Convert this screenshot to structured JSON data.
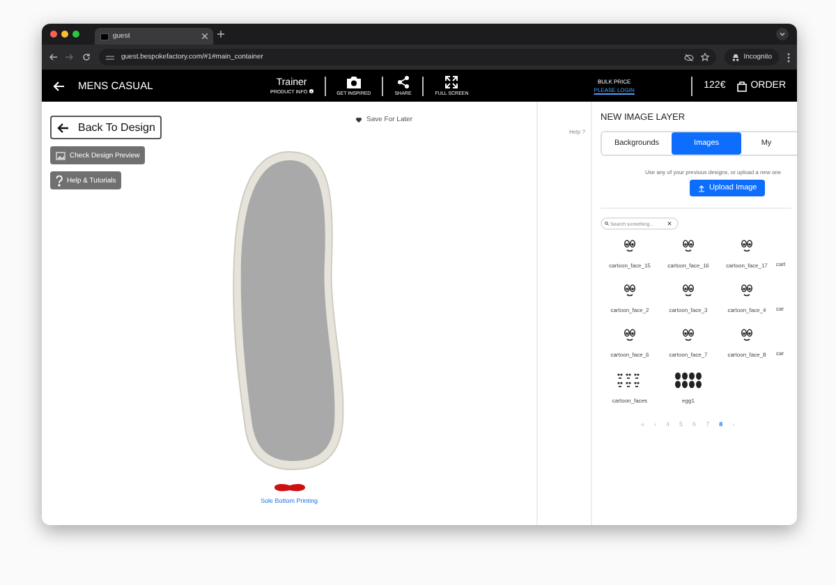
{
  "browser": {
    "tab_title": "guest",
    "url": "guest.bespokefactory.com/#1#main_container",
    "profile": "Incognito"
  },
  "header": {
    "title": "MENS CASUAL",
    "product": "Trainer",
    "product_info": "PRODUCT INFO",
    "actions": [
      {
        "kind": "camera",
        "label": "GET INSPIRED"
      },
      {
        "kind": "share",
        "label": "SHARE"
      },
      {
        "kind": "fullscreen",
        "label": "FULL SCREEN"
      }
    ],
    "bulk_price": "BULK PRICE",
    "login": "PLEASE LOGIN",
    "price": "122€",
    "order": "ORDER"
  },
  "design": {
    "buttons": [
      {
        "kind": "back",
        "label": "Back To Design"
      },
      {
        "kind": "preview",
        "label": "Check Design Preview"
      },
      {
        "kind": "help",
        "label": "Help & Tutorials"
      }
    ],
    "save": "Save For Later",
    "sole_link": "Sole Bottom Printing",
    "help": "Help ?"
  },
  "panel": {
    "title": "NEW IMAGE LAYER",
    "tabs": [
      {
        "label": "Backgrounds",
        "selected": false
      },
      {
        "label": "Images",
        "selected": true
      },
      {
        "label": "My",
        "selected": false
      }
    ],
    "hint": "Use any of your previous designs, or upload a new one",
    "upload": "Upload Image",
    "search": {
      "placeholder": "Search something..."
    },
    "images": [
      {
        "kind": "face",
        "label": "cartoon_face_15"
      },
      {
        "kind": "face",
        "label": "cartoon_face_16"
      },
      {
        "kind": "face",
        "label": "cartoon_face_17"
      },
      {
        "kind": "partial",
        "label": "cart"
      },
      {
        "kind": "face",
        "label": "cartoon_face_2"
      },
      {
        "kind": "face",
        "label": "cartoon_face_3"
      },
      {
        "kind": "face",
        "label": "cartoon_face_4"
      },
      {
        "kind": "partial",
        "label": "car"
      },
      {
        "kind": "face",
        "label": "cartoon_face_6"
      },
      {
        "kind": "face",
        "label": "cartoon_face_7"
      },
      {
        "kind": "face",
        "label": "cartoon_face_8"
      },
      {
        "kind": "partial",
        "label": "car"
      },
      {
        "kind": "faces",
        "label": "cartoon_faces"
      },
      {
        "kind": "eggs",
        "label": "egg1"
      }
    ],
    "pages": [
      {
        "label": "«",
        "selected": false
      },
      {
        "label": "‹",
        "selected": false
      },
      {
        "label": "4",
        "selected": false
      },
      {
        "label": "5",
        "selected": false
      },
      {
        "label": "6",
        "selected": false
      },
      {
        "label": "7",
        "selected": false
      },
      {
        "label": "8",
        "selected": true
      },
      {
        "label": "›",
        "selected": false
      }
    ]
  }
}
